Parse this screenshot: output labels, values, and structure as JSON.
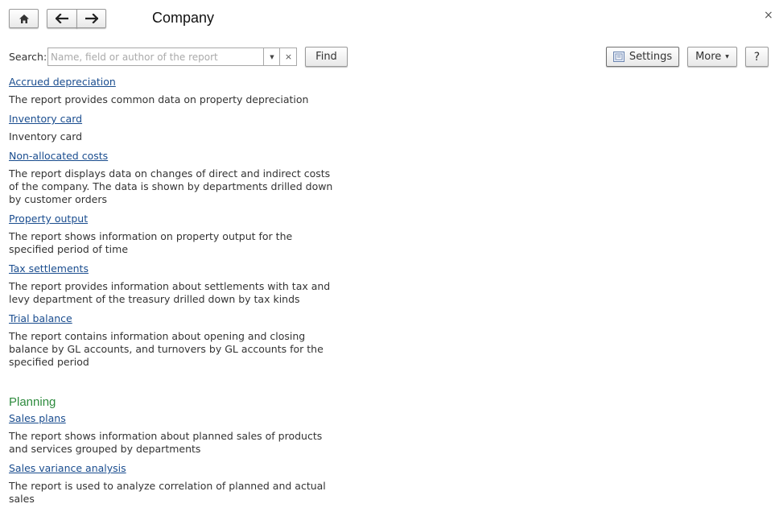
{
  "window": {
    "title": "Company",
    "close_label": "×"
  },
  "nav": {
    "home_icon": "home-icon",
    "back_icon": "arrow-left-icon",
    "forward_icon": "arrow-right-icon"
  },
  "search": {
    "label": "Search:",
    "placeholder": "Name, field or author of the report",
    "value": "",
    "dropdown_glyph": "▼",
    "clear_glyph": "×",
    "find_label": "Find"
  },
  "toolbar": {
    "settings_label": "Settings",
    "more_label": "More",
    "more_glyph": "▼",
    "help_label": "?"
  },
  "sections": [
    {
      "title": "",
      "items": [
        {
          "link": "Accrued depreciation",
          "desc": "The report provides common data on property depreciation"
        },
        {
          "link": "Inventory card",
          "desc": "Inventory card"
        },
        {
          "link": "Non-allocated costs",
          "desc": "The report displays data on changes of direct and indirect costs of the company. The data is shown by departments drilled down by customer orders"
        },
        {
          "link": "Property output",
          "desc": "The report shows information on property output for the specified period of time"
        },
        {
          "link": "Tax settlements",
          "desc": "The report provides information about settlements with tax and levy department of the treasury drilled down by tax kinds"
        },
        {
          "link": "Trial balance",
          "desc": "The report contains information about opening and closing balance by GL accounts, and turnovers by GL accounts for the specified period"
        }
      ]
    },
    {
      "title": "Planning",
      "items": [
        {
          "link": "Sales plans",
          "desc": "The report shows information about planned sales of products and services grouped by departments"
        },
        {
          "link": "Sales variance analysis",
          "desc": "The report is used to analyze correlation of planned and actual sales"
        }
      ]
    }
  ],
  "colors": {
    "link": "#1a4d8f",
    "group_title": "#2e8b3e",
    "text": "#333333"
  }
}
